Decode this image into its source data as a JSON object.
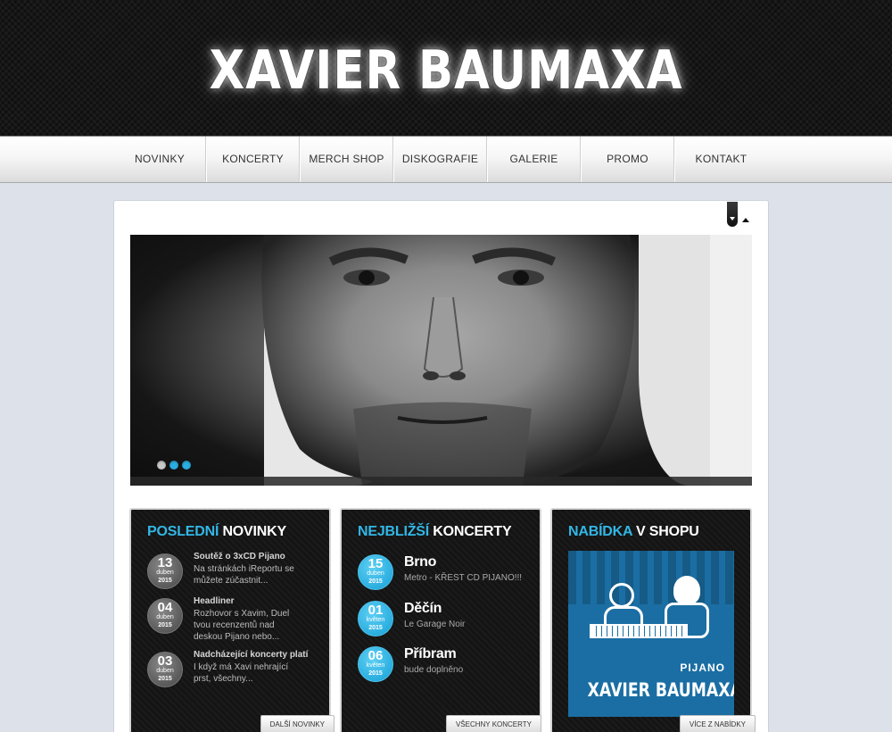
{
  "header": {
    "logo_text": "XAVIER BAUMAXA"
  },
  "nav": {
    "items": [
      {
        "label": "NOVINKY"
      },
      {
        "label": "KONCERTY"
      },
      {
        "label": "MERCH SHOP"
      },
      {
        "label": "DISKOGRAFIE"
      },
      {
        "label": "GALERIE"
      },
      {
        "label": "PROMO"
      },
      {
        "label": "KONTAKT"
      }
    ]
  },
  "slider": {
    "slide_count": 3,
    "active_slide": 1,
    "colors": {
      "inactive": "#c8c8c8",
      "active": "#2aaee0"
    }
  },
  "news": {
    "title_highlight": "POSLEDNÍ",
    "title_rest": "NOVINKY",
    "items": [
      {
        "day": "13",
        "month": "duben",
        "year": "2015",
        "title": "Soutěž o 3xCD Pijano",
        "text": "Na stránkách iReportu se můžete zúčastnit..."
      },
      {
        "day": "04",
        "month": "duben",
        "year": "2015",
        "title": "Headliner",
        "text": "Rozhovor s Xavim, Duel tvou recenzentů nad deskou Pijano nebo..."
      },
      {
        "day": "03",
        "month": "duben",
        "year": "2015",
        "title": "Nadcházející koncerty platí",
        "text": "I když má Xavi nehrající prst, všechny..."
      }
    ],
    "button_label": "DALŠÍ NOVINKY"
  },
  "concerts": {
    "title_highlight": "NEJBLIŽŠÍ",
    "title_rest": "KONCERTY",
    "items": [
      {
        "day": "15",
        "month": "duben",
        "year": "2015",
        "city": "Brno",
        "venue": "Metro - KŘEST CD PIJANO!!!"
      },
      {
        "day": "01",
        "month": "květen",
        "year": "2015",
        "city": "Děčín",
        "venue": "Le Garage Noir"
      },
      {
        "day": "06",
        "month": "květen",
        "year": "2015",
        "city": "Příbram",
        "venue": "bude doplněno"
      }
    ],
    "button_label": "VŠECHNY KONCERTY"
  },
  "shop": {
    "title_highlight": "NABÍDKA",
    "title_rest": "V SHOPU",
    "cover_text_small": "PIJANO",
    "cover_text_large": "XAVIER BAUMAXA",
    "button_label": "VÍCE Z NABÍDKY"
  },
  "colors": {
    "accent": "#32b7e6",
    "page_bg": "#dde1ea",
    "box_bg": "#141414"
  }
}
